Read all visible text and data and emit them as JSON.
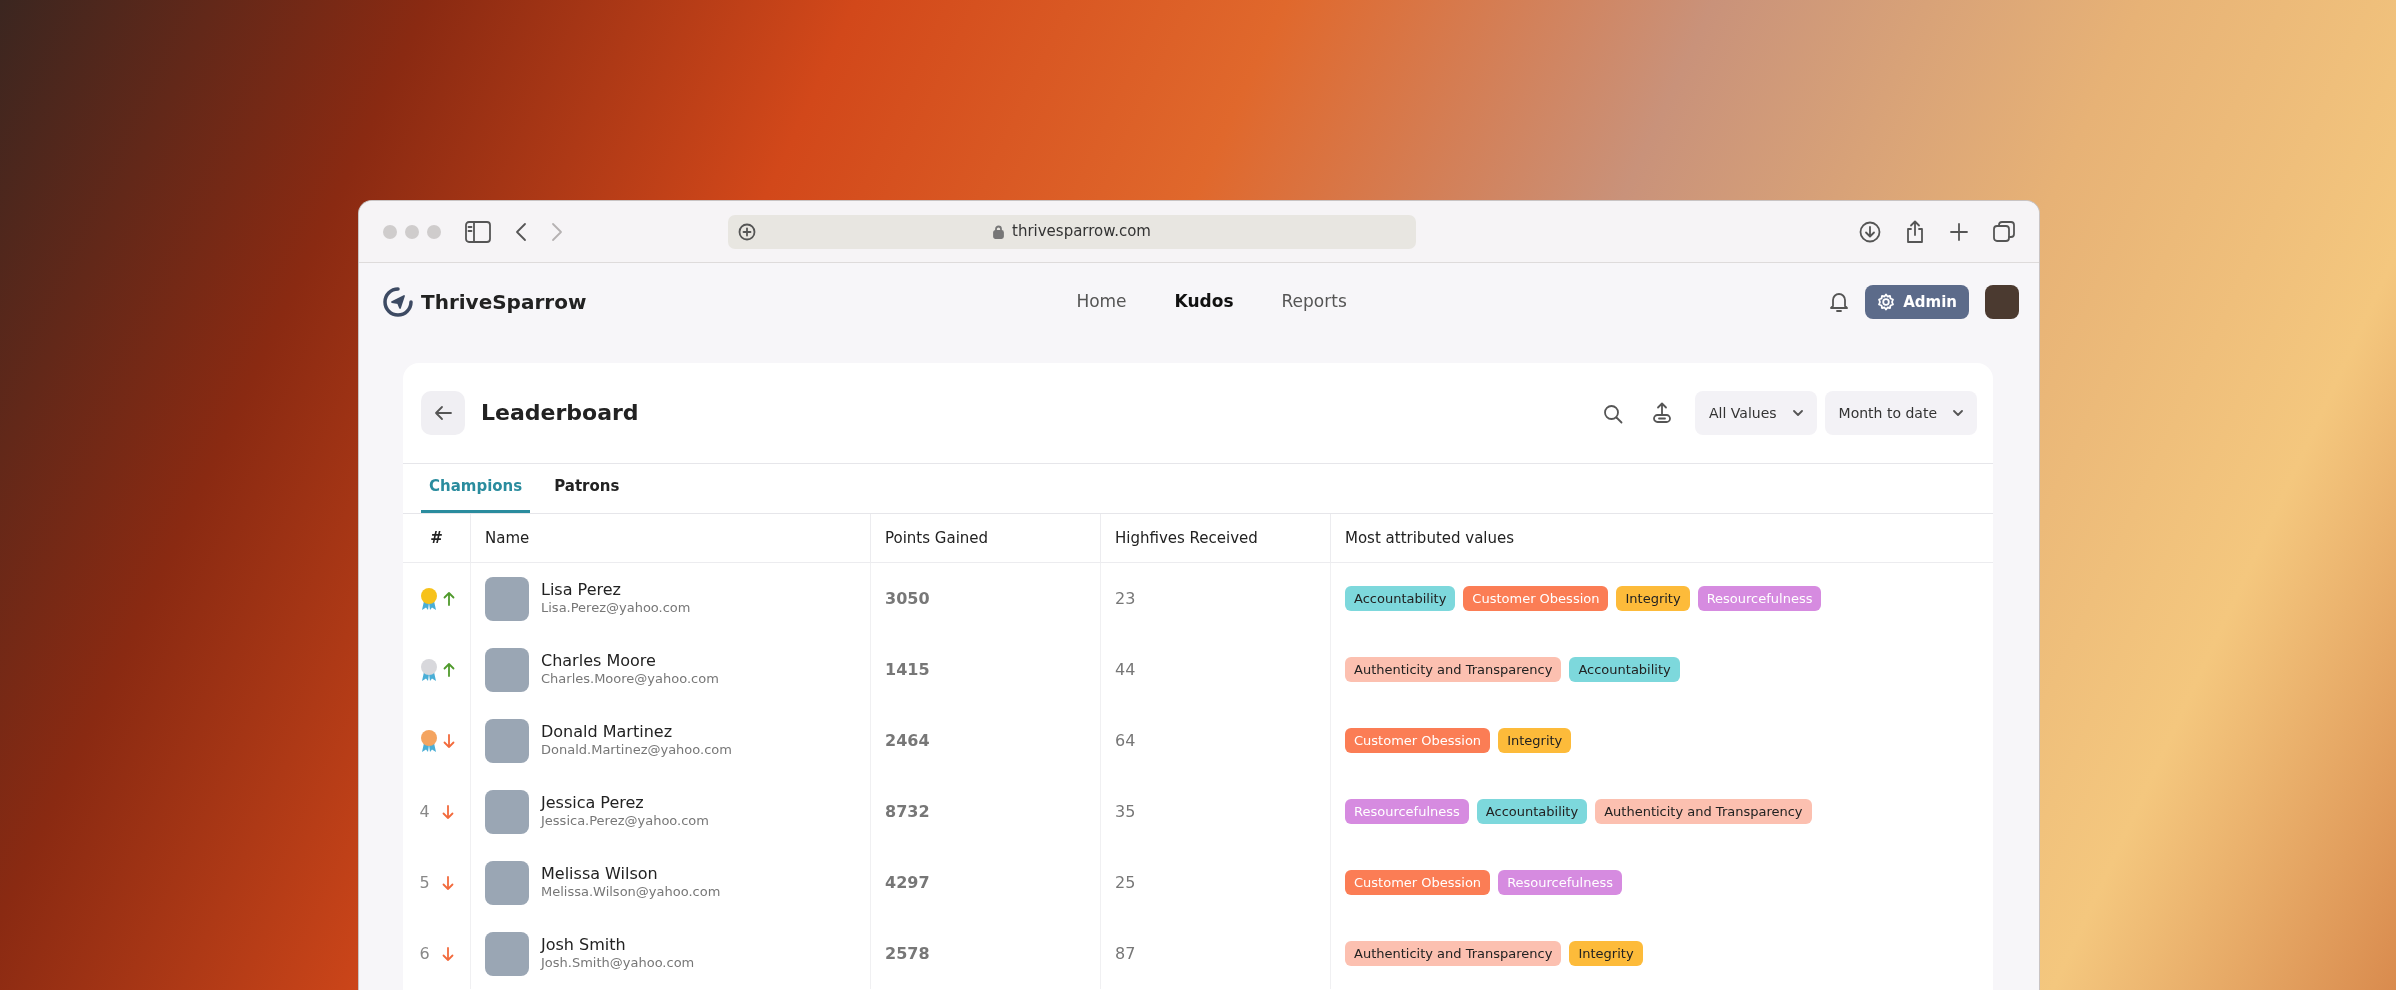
{
  "browser": {
    "url": "thrivesparrow.com"
  },
  "app": {
    "brand": "ThriveSparrow",
    "admin_button": "Admin",
    "nav": [
      {
        "label": "Home",
        "selected": false
      },
      {
        "label": "Kudos",
        "selected": true
      },
      {
        "label": "Reports",
        "selected": false
      }
    ]
  },
  "page": {
    "title": "Leaderboard",
    "filters": [
      "All Values",
      "Month to date"
    ],
    "tabs": [
      {
        "label": "Champions",
        "selected": true
      },
      {
        "label": "Patrons",
        "selected": false
      }
    ],
    "table": {
      "columns": [
        "#",
        "Name",
        "Points Gained",
        "Highfives Received",
        "Most attributed values"
      ],
      "rows": [
        {
          "kind": "gold",
          "rising": true,
          "name": "Lisa Perez",
          "email": "Lisa.Perez@yahoo.com",
          "points": "3050",
          "highfives": "23",
          "values": [
            {
              "label": "Accountability",
              "color": "#7dd8dc"
            },
            {
              "label": "Customer Obession",
              "color": "#fb7d55"
            },
            {
              "label": "Integrity",
              "color": "#fdbb3a"
            },
            {
              "label": "Resourcefulness",
              "color": "#d68be0"
            }
          ]
        },
        {
          "kind": "silver",
          "rising": true,
          "name": "Charles Moore",
          "email": "Charles.Moore@yahoo.com",
          "points": "1415",
          "highfives": "44",
          "values": [
            {
              "label": "Authenticity and Transparency",
              "color": "#fcc0b0"
            },
            {
              "label": "Accountability",
              "color": "#7dd8dc"
            }
          ]
        },
        {
          "kind": "bronze",
          "rising": false,
          "name": "Donald Martinez",
          "email": "Donald.Martinez@yahoo.com",
          "points": "2464",
          "highfives": "64",
          "values": [
            {
              "label": "Customer Obession",
              "color": "#fb7d55"
            },
            {
              "label": "Integrity",
              "color": "#fdbb3a"
            }
          ]
        },
        {
          "kind": "number",
          "rank": "4",
          "rising": false,
          "name": "Jessica Perez",
          "email": "Jessica.Perez@yahoo.com",
          "points": "8732",
          "highfives": "35",
          "values": [
            {
              "label": "Resourcefulness",
              "color": "#d68be0"
            },
            {
              "label": "Accountability",
              "color": "#7dd8dc"
            },
            {
              "label": "Authenticity and Transparency",
              "color": "#fcc0b0"
            }
          ]
        },
        {
          "kind": "number",
          "rank": "5",
          "rising": false,
          "name": "Melissa Wilson",
          "email": "Melissa.Wilson@yahoo.com",
          "points": "4297",
          "highfives": "25",
          "values": [
            {
              "label": "Customer Obession",
              "color": "#fb7d55"
            },
            {
              "label": "Resourcefulness",
              "color": "#d68be0"
            }
          ]
        },
        {
          "kind": "number",
          "rank": "6",
          "rising": false,
          "name": "Josh Smith",
          "email": "Josh.Smith@yahoo.com",
          "points": "2578",
          "highfives": "87",
          "values": [
            {
              "label": "Authenticity and Transparency",
              "color": "#fcc0b0"
            },
            {
              "label": "Integrity",
              "color": "#fdbb3a"
            }
          ]
        }
      ]
    }
  }
}
